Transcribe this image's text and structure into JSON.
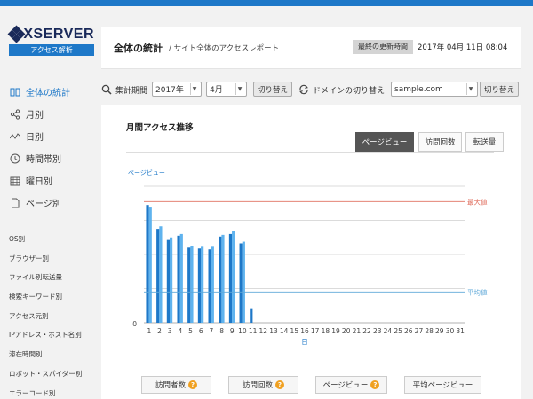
{
  "brand": {
    "name": "XSERVER",
    "badge": "アクセス解析"
  },
  "sidebar": {
    "items": [
      {
        "label": "全体の統計",
        "icon": "summary-icon",
        "active": true
      },
      {
        "label": "月別",
        "icon": "share-icon"
      },
      {
        "label": "日別",
        "icon": "wave-icon"
      },
      {
        "label": "時間帯別",
        "icon": "clock-icon"
      },
      {
        "label": "曜日別",
        "icon": "calendar-icon"
      },
      {
        "label": "ページ別",
        "icon": "document-icon"
      }
    ],
    "sub_items": [
      "OS別",
      "ブラウザー別",
      "ファイル別転送量",
      "検索キーワード別",
      "アクセス元別",
      "IPアドレス・ホスト名別",
      "滞在時間別",
      "ロボット・スパイダー別",
      "エラーコード別"
    ]
  },
  "header": {
    "title": "全体の統計",
    "subtitle": "/ サイト全体のアクセスレポート",
    "updated_label": "最終の更新時間",
    "updated_value": "2017年 04月 11日 08:04"
  },
  "controls": {
    "period_label": "集計期間",
    "year": "2017年",
    "month": "4月",
    "switch_label": "切り替え",
    "domain_label": "ドメインの切り替え",
    "domain": "sample.com",
    "switch2_label": "切り替え"
  },
  "panel": {
    "title": "月間アクセス推移",
    "tabs": [
      {
        "label": "ページビュー",
        "active": true
      },
      {
        "label": "訪問回数"
      },
      {
        "label": "転送量"
      }
    ],
    "summary": [
      {
        "label": "訪問者数",
        "help": true
      },
      {
        "label": "訪問回数",
        "help": true
      },
      {
        "label": "ページビュー",
        "help": true
      },
      {
        "label": "平均ページビュー",
        "help": false
      }
    ]
  },
  "colors": {
    "accent": "#1e78c8",
    "bar_dark": "#1e78c8",
    "bar_light": "#5fb3ee",
    "max_line": "#e07060",
    "avg_line": "#5fa8d8"
  },
  "chart_data": {
    "type": "bar",
    "ylabel": "ページビュー",
    "xlabel": "日",
    "ytick_zero": "0",
    "categories": [
      "1",
      "2",
      "3",
      "4",
      "5",
      "6",
      "7",
      "8",
      "9",
      "10",
      "11",
      "12",
      "13",
      "14",
      "15",
      "16",
      "17",
      "18",
      "19",
      "20",
      "21",
      "22",
      "23",
      "24",
      "25",
      "26",
      "27",
      "28",
      "29",
      "30",
      "31"
    ],
    "series": [
      {
        "values": [
          138,
          110,
          97,
          102,
          88,
          87,
          86,
          101,
          104,
          93,
          17,
          0,
          0,
          0,
          0,
          0,
          0,
          0,
          0,
          0,
          0,
          0,
          0,
          0,
          0,
          0,
          0,
          0,
          0,
          0,
          0
        ],
        "color": "#1e78c8"
      },
      {
        "values": [
          135,
          113,
          100,
          104,
          90,
          89,
          89,
          103,
          107,
          95,
          0,
          0,
          0,
          0,
          0,
          0,
          0,
          0,
          0,
          0,
          0,
          0,
          0,
          0,
          0,
          0,
          0,
          0,
          0,
          0,
          0
        ],
        "color": "#5fb3ee"
      }
    ],
    "ylim": [
      0,
      160
    ],
    "reference_lines": [
      {
        "label": "最大値",
        "value": 142,
        "color": "#e07060"
      },
      {
        "label": "平均値",
        "value": 36,
        "color": "#5fa8d8"
      }
    ]
  }
}
